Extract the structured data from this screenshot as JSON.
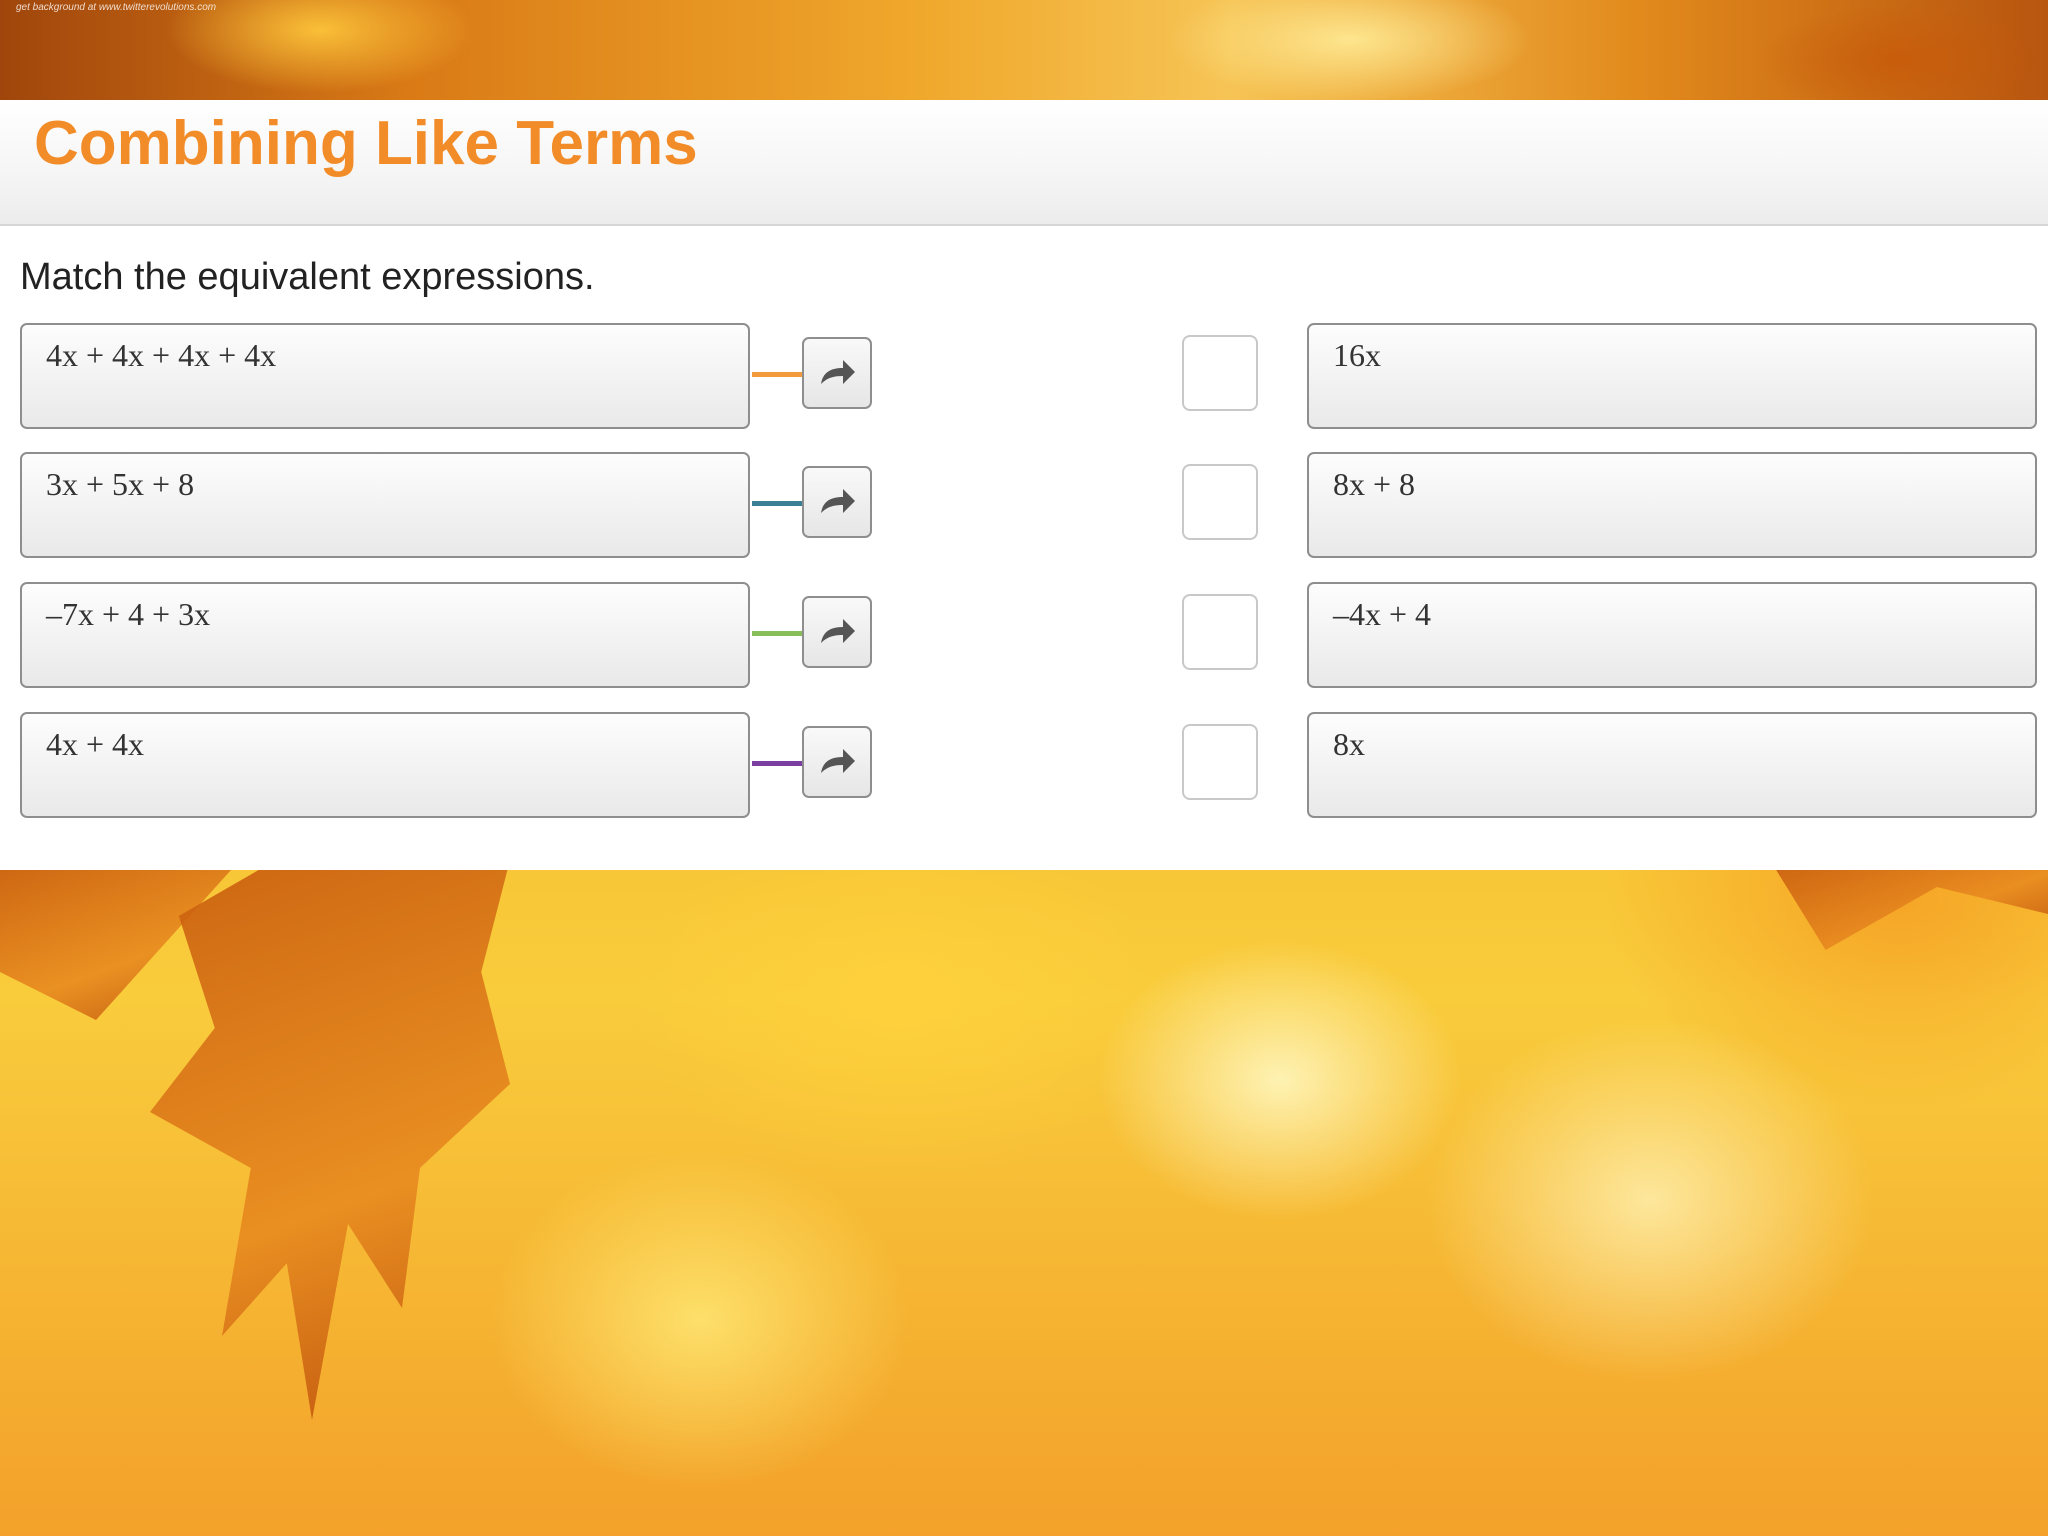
{
  "banner": {
    "credit": "get background at www.twitterevolutions.com"
  },
  "header": {
    "title": "Combining Like Terms"
  },
  "instructions": "Match the equivalent expressions.",
  "left_items": [
    {
      "label": "4x + 4x + 4x + 4x",
      "connector_color": "#f39a3c"
    },
    {
      "label": "3x + 5x + 8",
      "connector_color": "#3b7f97"
    },
    {
      "label": "–7x + 4 + 3x",
      "connector_color": "#86bf5a"
    },
    {
      "label": "4x + 4x",
      "connector_color": "#7a3fa1"
    }
  ],
  "right_items": [
    {
      "label": "16x"
    },
    {
      "label": "8x + 8"
    },
    {
      "label": "–4x + 4"
    },
    {
      "label": "8x"
    }
  ],
  "icons": {
    "arrow_button": "curved-arrow-right-icon"
  },
  "colors": {
    "title": "#f28c28"
  }
}
